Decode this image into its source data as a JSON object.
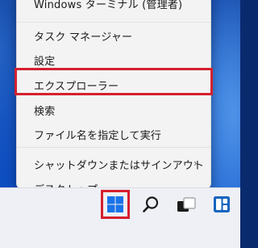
{
  "menu": {
    "items": [
      {
        "label": "Windows ターミナル (管理者)"
      },
      {
        "label": "タスク マネージャー"
      },
      {
        "label": "設定"
      },
      {
        "label": "エクスプローラー"
      },
      {
        "label": "検索"
      },
      {
        "label": "ファイル名を指定して実行"
      },
      {
        "label": "シャットダウンまたはサインアウト",
        "submenu": true
      },
      {
        "label": "デスクトップ"
      }
    ],
    "highlighted_item": "エクスプローラー"
  },
  "taskbar": {
    "icons": [
      "windows-start-icon",
      "search-icon",
      "task-view-icon",
      "widgets-icon"
    ],
    "highlighted": "windows-start-icon"
  },
  "colors": {
    "highlight_border": "#d5202e",
    "start_icon": "#1a73e8",
    "menu_bg": "#f3f3f3"
  }
}
